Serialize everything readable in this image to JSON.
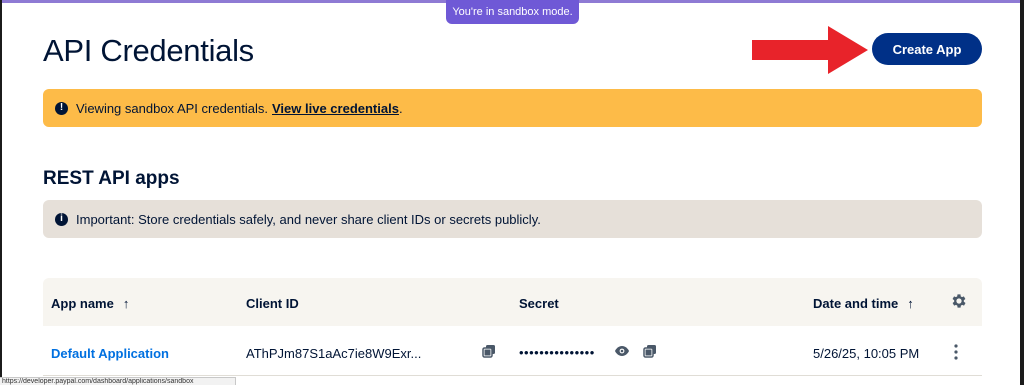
{
  "banner": {
    "sandbox_text": "You're in sandbox mode."
  },
  "header": {
    "title": "API Credentials",
    "create_button_label": "Create App"
  },
  "alerts": {
    "warning_text": "Viewing sandbox API credentials.",
    "warning_link": "View live credentials",
    "warning_suffix": ".",
    "info_text": "Important: Store credentials safely, and never share client IDs or secrets publicly."
  },
  "section": {
    "title": "REST API apps"
  },
  "table": {
    "headers": {
      "app_name": "App name",
      "client_id": "Client ID",
      "secret": "Secret",
      "date_time": "Date and time"
    },
    "sort_arrow": "↑",
    "rows": [
      {
        "app_name": "Default Application",
        "client_id": "AThPJm87S1aAc7ie8W9Exr...",
        "secret": "•••••••••••••••",
        "date_time": "5/26/25, 10:05 PM"
      }
    ]
  },
  "status_bar": {
    "url": "https://developer.paypal.com/dashboard/applications/sandbox"
  },
  "colors": {
    "primary_button": "#003087",
    "warning_bg": "#fdbb48",
    "info_bg": "#e6e0d9",
    "link": "#0070e0",
    "sandbox_pill": "#6f59d6",
    "annotation_arrow": "#e8232a"
  },
  "icons": [
    "alert-exclamation-icon",
    "info-icon",
    "sort-up-icon",
    "gear-icon",
    "copy-icon",
    "eye-icon",
    "kebab-menu-icon",
    "red-arrow-annotation"
  ]
}
